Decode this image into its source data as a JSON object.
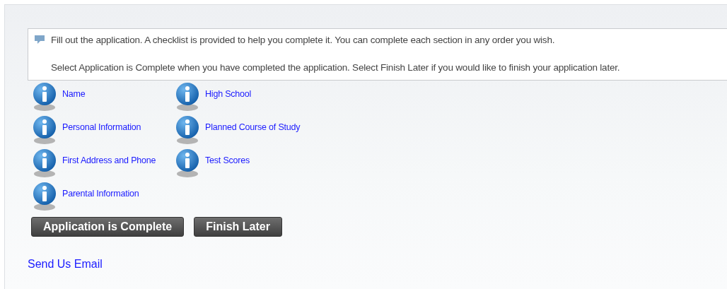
{
  "message": {
    "lines": [
      "Fill out the application. A checklist is provided to help you complete it. You can complete each section in any order you wish.",
      "Select Application is Complete when you have completed the application. Select Finish Later if you would like to finish your application later."
    ]
  },
  "checklist": [
    {
      "label": "Name"
    },
    {
      "label": "Personal Information"
    },
    {
      "label": "First Address and Phone"
    },
    {
      "label": "Parental Information"
    },
    {
      "label": "High School"
    },
    {
      "label": "Planned Course of Study"
    },
    {
      "label": "Test Scores"
    }
  ],
  "buttons": [
    "Application is Complete",
    "Finish Later"
  ],
  "footer_link": "Send Us Email"
}
